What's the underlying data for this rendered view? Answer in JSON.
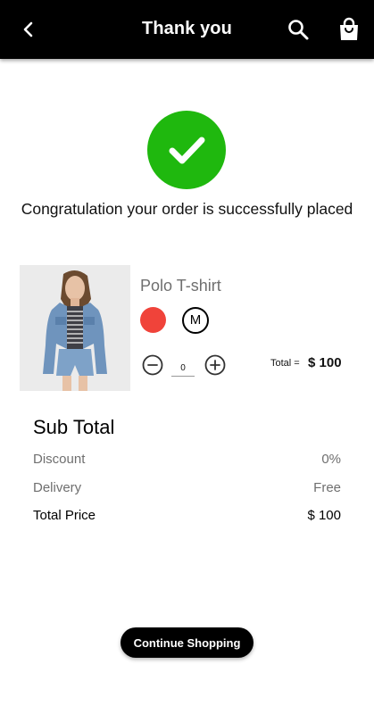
{
  "header": {
    "title": "Thank you",
    "back_icon": "chevron-left-icon",
    "search_icon": "search-icon",
    "bag_icon": "shopping-bag-icon"
  },
  "confirmation": {
    "icon": "checkmark-icon",
    "icon_color": "#1fb80e",
    "message": "Congratulation your order is successfully placed"
  },
  "product": {
    "name": "Polo T-shirt",
    "color_hex": "#f0433a",
    "size": "M",
    "quantity": "0",
    "total_label": "Total =",
    "total_value": "$ 100"
  },
  "summary": {
    "title": "Sub Total",
    "rows": [
      {
        "label": "Discount",
        "value": "0%"
      },
      {
        "label": "Delivery",
        "value": "Free"
      },
      {
        "label": "Total Price",
        "value": "$ 100"
      }
    ]
  },
  "actions": {
    "continue_label": "Continue Shopping"
  },
  "colors": {
    "appbar_bg": "#000000",
    "accent_success": "#1fb80e",
    "muted_text": "#6f6f6f"
  }
}
